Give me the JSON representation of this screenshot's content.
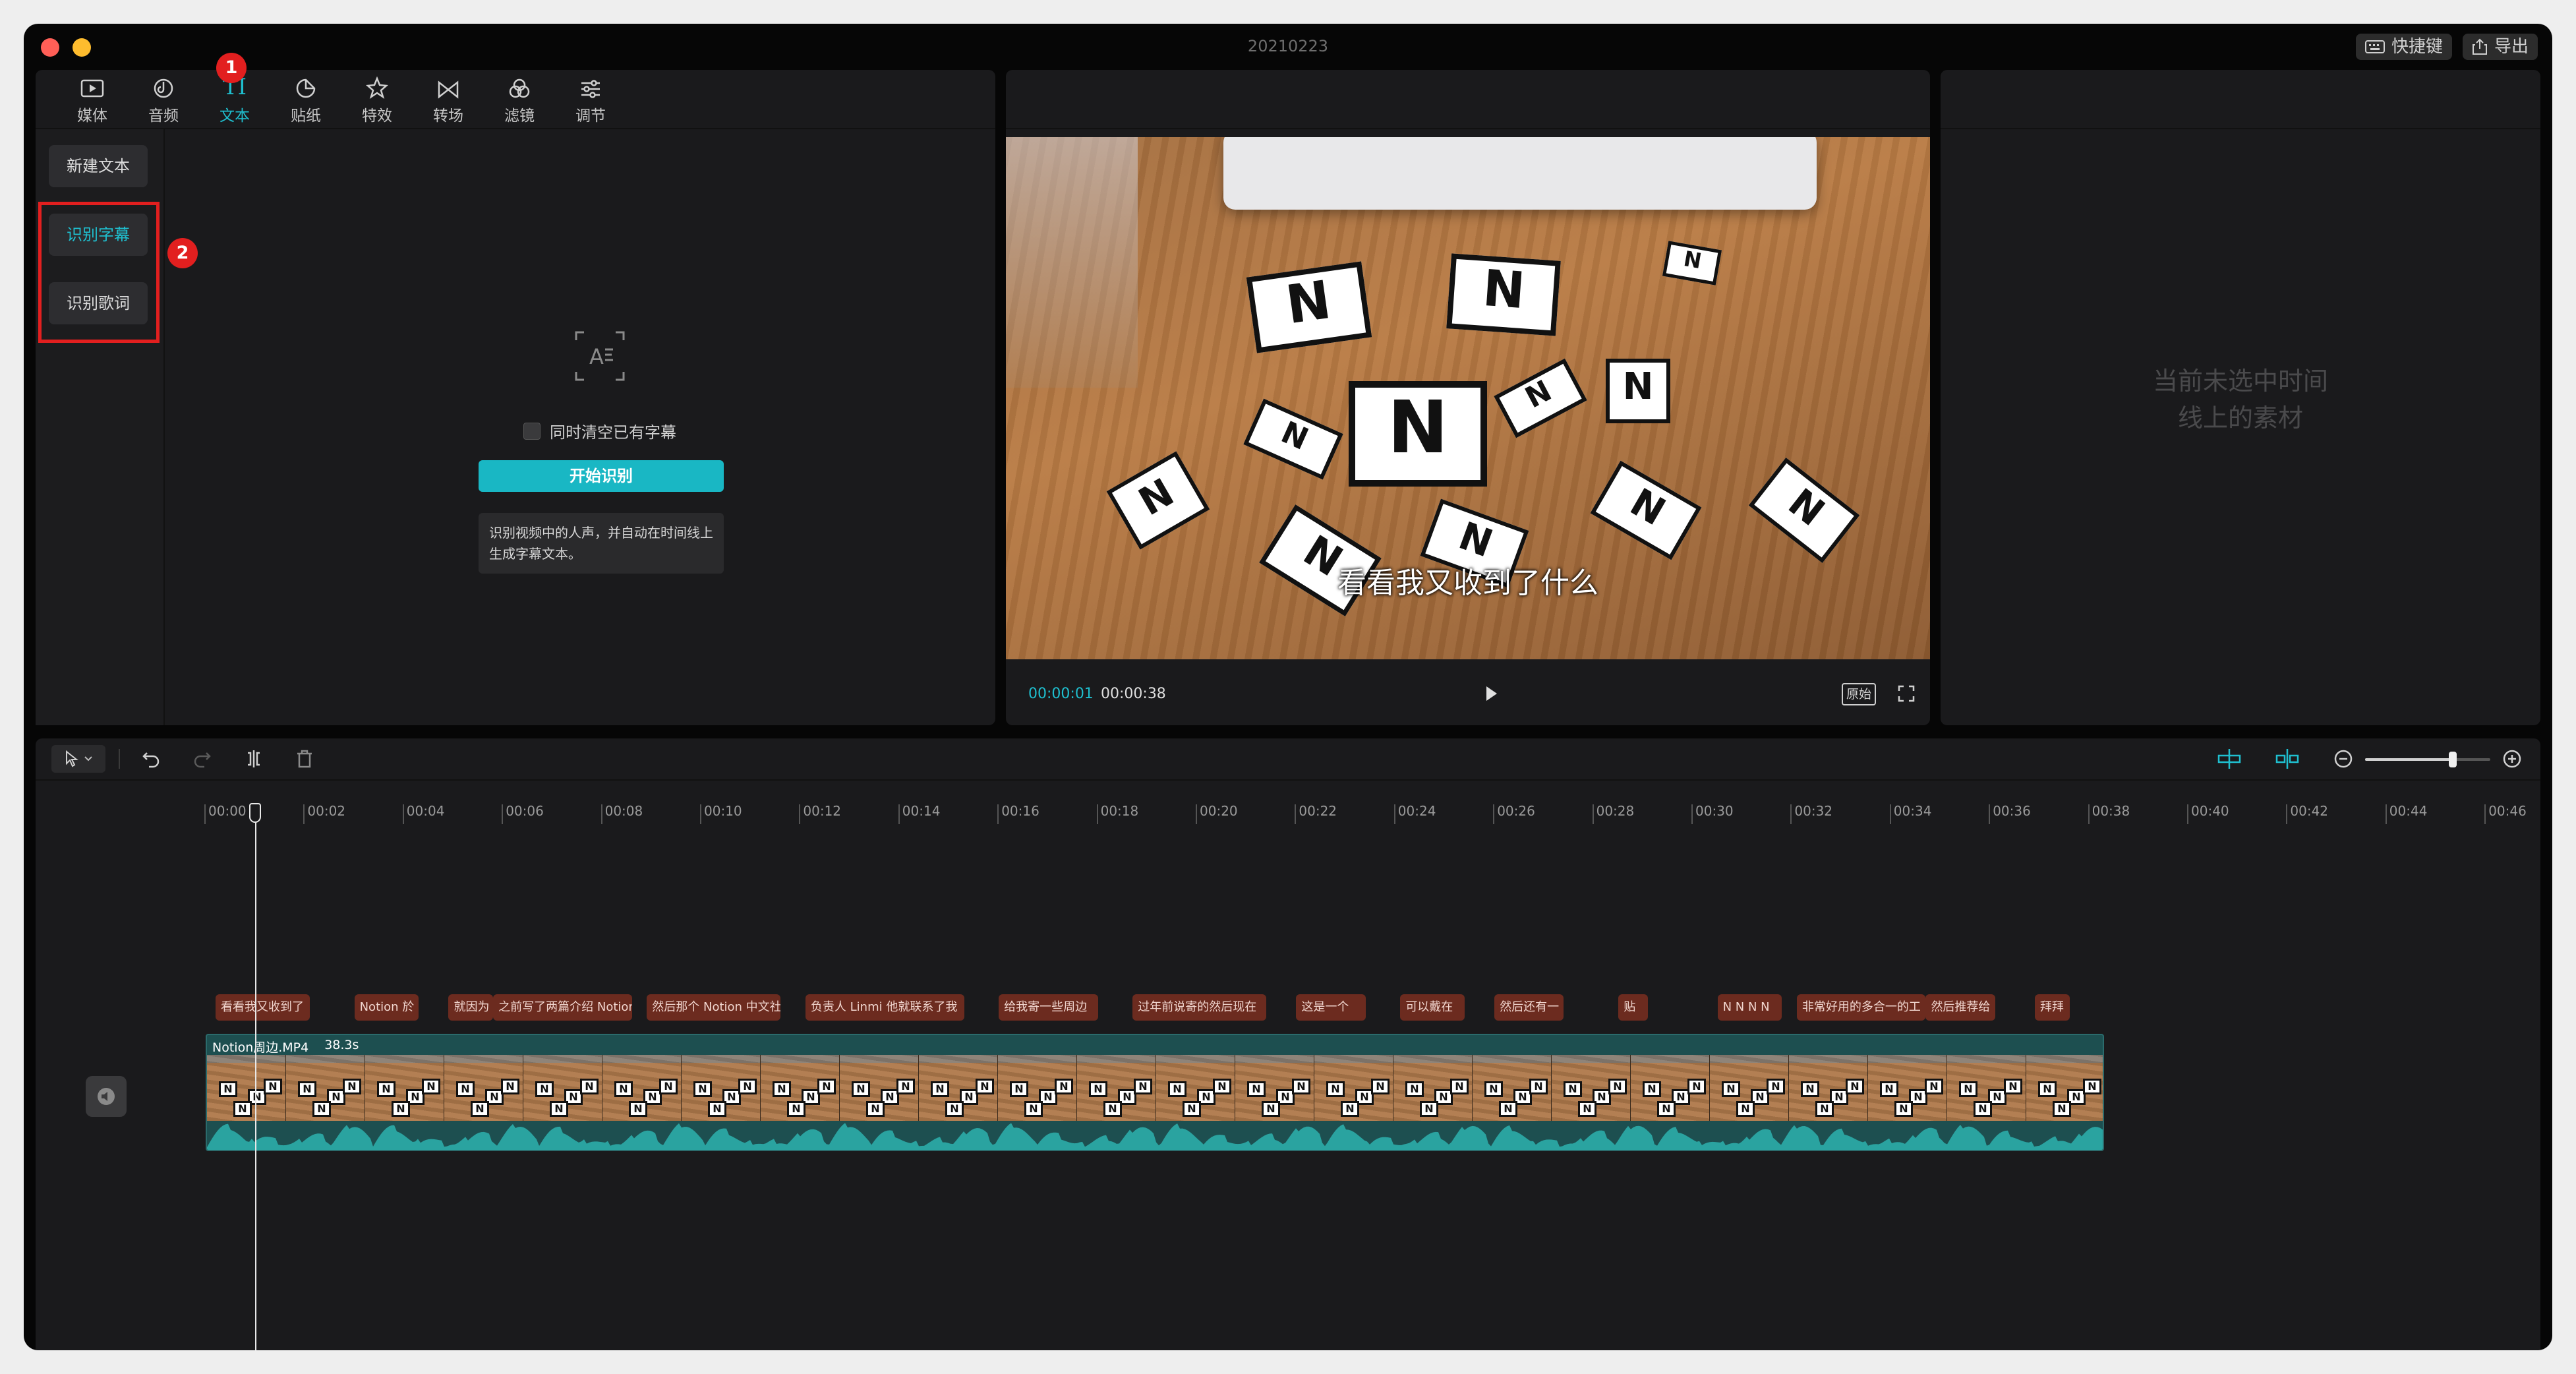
{
  "window": {
    "title": "20210223",
    "shortcuts_label": "快捷键",
    "export_label": "导出"
  },
  "tabs": [
    {
      "label": "媒体",
      "icon": "media-icon"
    },
    {
      "label": "音频",
      "icon": "audio-icon"
    },
    {
      "label": "文本",
      "icon": "text-icon",
      "active": true
    },
    {
      "label": "贴纸",
      "icon": "sticker-icon"
    },
    {
      "label": "特效",
      "icon": "effects-icon"
    },
    {
      "label": "转场",
      "icon": "transition-icon"
    },
    {
      "label": "滤镜",
      "icon": "filter-icon"
    },
    {
      "label": "调节",
      "icon": "adjust-icon"
    }
  ],
  "sidebar": {
    "items": [
      {
        "label": "新建文本"
      },
      {
        "label": "识别字幕",
        "active": true
      },
      {
        "label": "识别歌词"
      }
    ]
  },
  "recognize": {
    "checkbox_label": "同时清空已有字幕",
    "checked": false,
    "start_button": "开始识别",
    "description": "识别视频中的人声，并自动在时间线上生成字幕文本。"
  },
  "annotations": [
    "1",
    "2"
  ],
  "player": {
    "subtitle": "看看我又收到了什么",
    "current_time": "00:00:01",
    "total_time": "00:00:38",
    "ratio_label": "原始"
  },
  "inspector": {
    "empty_line1": "当前未选中时间",
    "empty_line2": "线上的素材"
  },
  "timeline": {
    "ruler": [
      "00:00",
      "00:02",
      "00:04",
      "00:06",
      "00:08",
      "00:10",
      "00:12",
      "00:14",
      "00:16",
      "00:18",
      "00:20",
      "00:22",
      "00:24",
      "00:26",
      "00:28",
      "00:30",
      "00:32",
      "00:34",
      "00:36",
      "00:38",
      "00:40",
      "00:42",
      "00:44",
      "00:46"
    ],
    "zoom_level": 0.7,
    "subtitles": [
      {
        "text": "看看我又收到了",
        "start": 0.2,
        "end": 2.1
      },
      {
        "text": "Notion 於",
        "start": 3.0,
        "end": 4.3
      },
      {
        "text": "就因为",
        "start": 4.9,
        "end": 5.8
      },
      {
        "text": "之前写了两篇介绍 Notion",
        "start": 5.8,
        "end": 8.6
      },
      {
        "text": "然后那个 Notion 中文社",
        "start": 8.9,
        "end": 11.6
      },
      {
        "text": "负责人 Linmi 他就联系了我",
        "start": 12.1,
        "end": 15.3
      },
      {
        "text": "给我寄一些周边",
        "start": 16.0,
        "end": 18.0
      },
      {
        "text": "过年前说寄的然后现在",
        "start": 18.7,
        "end": 21.4
      },
      {
        "text": "这是一个",
        "start": 22.0,
        "end": 23.4
      },
      {
        "text": "可以戴在",
        "start": 24.1,
        "end": 25.4
      },
      {
        "text": "然后还有一",
        "start": 26.0,
        "end": 27.4
      },
      {
        "text": "贴",
        "start": 28.5,
        "end": 29.1
      },
      {
        "text": "N N N N",
        "start": 30.5,
        "end": 31.8
      },
      {
        "text": "非常好用的多合一的工",
        "start": 32.1,
        "end": 34.7
      },
      {
        "text": "然后推荐给",
        "start": 34.7,
        "end": 36.1
      },
      {
        "text": "拜拜",
        "start": 36.9,
        "end": 37.6
      }
    ],
    "clip": {
      "name": "Notion周边.MP4",
      "duration": "38.3s",
      "start": 0,
      "end": 38.3
    }
  }
}
